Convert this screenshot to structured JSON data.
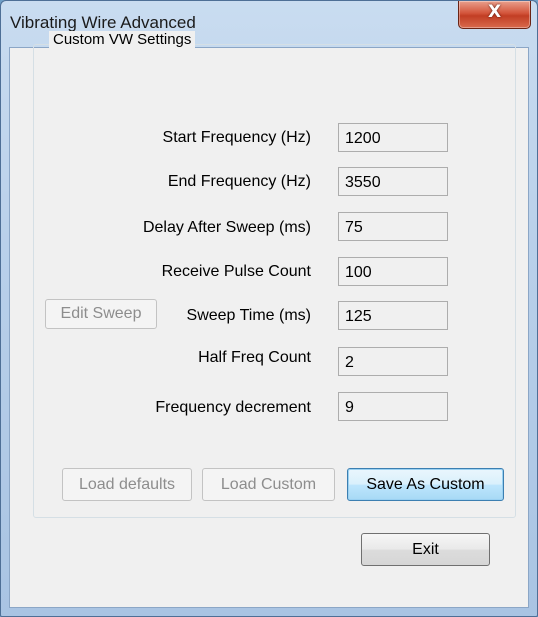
{
  "window": {
    "title": "Vibrating Wire Advanced",
    "close_glyph": "X"
  },
  "group": {
    "label": "Custom VW Settings"
  },
  "fields": [
    {
      "label": "Start Frequency (Hz)",
      "value": "1200"
    },
    {
      "label": "End Frequency (Hz)",
      "value": "3550"
    },
    {
      "label": "Delay After Sweep (ms)",
      "value": "75"
    },
    {
      "label": "Receive Pulse Count",
      "value": "100"
    },
    {
      "label": "Sweep Time (ms)",
      "value": "125"
    },
    {
      "label": "Half Freq Count",
      "value": "2"
    },
    {
      "label": "Frequency decrement",
      "value": "9"
    }
  ],
  "buttons": {
    "edit_sweep": "Edit Sweep",
    "load_defaults": "Load defaults",
    "load_custom": "Load Custom",
    "save_as_custom": "Save As Custom",
    "exit": "Exit"
  },
  "icons": {
    "close": "close-icon"
  },
  "colors": {
    "title_bar": "#b9d0ea",
    "close_button": "#c94a2f",
    "dialog_background": "#f0f0f0",
    "focus_button": "#bee6fd"
  }
}
